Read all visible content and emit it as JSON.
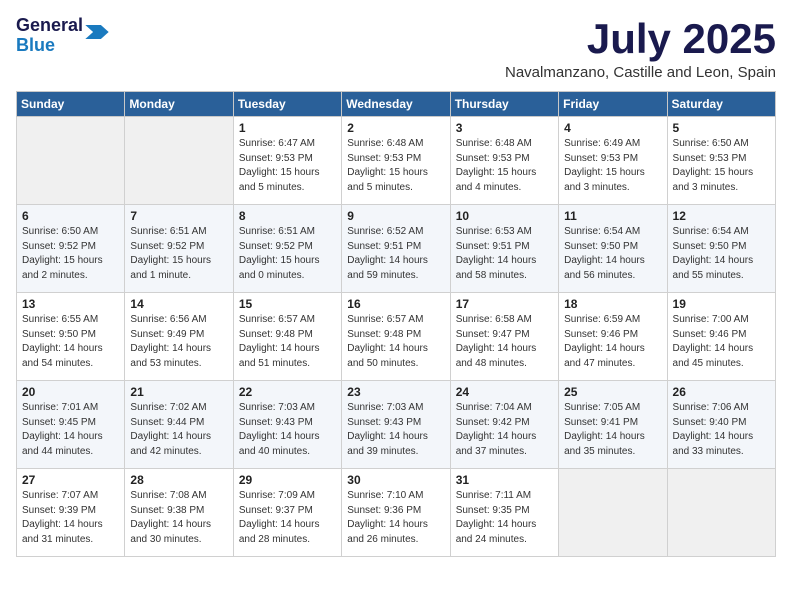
{
  "header": {
    "logo_line1": "General",
    "logo_line2": "Blue",
    "month": "July 2025",
    "location": "Navalmanzano, Castille and Leon, Spain"
  },
  "days_of_week": [
    "Sunday",
    "Monday",
    "Tuesday",
    "Wednesday",
    "Thursday",
    "Friday",
    "Saturday"
  ],
  "weeks": [
    [
      {
        "day": "",
        "info": ""
      },
      {
        "day": "",
        "info": ""
      },
      {
        "day": "1",
        "info": "Sunrise: 6:47 AM\nSunset: 9:53 PM\nDaylight: 15 hours\nand 5 minutes."
      },
      {
        "day": "2",
        "info": "Sunrise: 6:48 AM\nSunset: 9:53 PM\nDaylight: 15 hours\nand 5 minutes."
      },
      {
        "day": "3",
        "info": "Sunrise: 6:48 AM\nSunset: 9:53 PM\nDaylight: 15 hours\nand 4 minutes."
      },
      {
        "day": "4",
        "info": "Sunrise: 6:49 AM\nSunset: 9:53 PM\nDaylight: 15 hours\nand 3 minutes."
      },
      {
        "day": "5",
        "info": "Sunrise: 6:50 AM\nSunset: 9:53 PM\nDaylight: 15 hours\nand 3 minutes."
      }
    ],
    [
      {
        "day": "6",
        "info": "Sunrise: 6:50 AM\nSunset: 9:52 PM\nDaylight: 15 hours\nand 2 minutes."
      },
      {
        "day": "7",
        "info": "Sunrise: 6:51 AM\nSunset: 9:52 PM\nDaylight: 15 hours\nand 1 minute."
      },
      {
        "day": "8",
        "info": "Sunrise: 6:51 AM\nSunset: 9:52 PM\nDaylight: 15 hours\nand 0 minutes."
      },
      {
        "day": "9",
        "info": "Sunrise: 6:52 AM\nSunset: 9:51 PM\nDaylight: 14 hours\nand 59 minutes."
      },
      {
        "day": "10",
        "info": "Sunrise: 6:53 AM\nSunset: 9:51 PM\nDaylight: 14 hours\nand 58 minutes."
      },
      {
        "day": "11",
        "info": "Sunrise: 6:54 AM\nSunset: 9:50 PM\nDaylight: 14 hours\nand 56 minutes."
      },
      {
        "day": "12",
        "info": "Sunrise: 6:54 AM\nSunset: 9:50 PM\nDaylight: 14 hours\nand 55 minutes."
      }
    ],
    [
      {
        "day": "13",
        "info": "Sunrise: 6:55 AM\nSunset: 9:50 PM\nDaylight: 14 hours\nand 54 minutes."
      },
      {
        "day": "14",
        "info": "Sunrise: 6:56 AM\nSunset: 9:49 PM\nDaylight: 14 hours\nand 53 minutes."
      },
      {
        "day": "15",
        "info": "Sunrise: 6:57 AM\nSunset: 9:48 PM\nDaylight: 14 hours\nand 51 minutes."
      },
      {
        "day": "16",
        "info": "Sunrise: 6:57 AM\nSunset: 9:48 PM\nDaylight: 14 hours\nand 50 minutes."
      },
      {
        "day": "17",
        "info": "Sunrise: 6:58 AM\nSunset: 9:47 PM\nDaylight: 14 hours\nand 48 minutes."
      },
      {
        "day": "18",
        "info": "Sunrise: 6:59 AM\nSunset: 9:46 PM\nDaylight: 14 hours\nand 47 minutes."
      },
      {
        "day": "19",
        "info": "Sunrise: 7:00 AM\nSunset: 9:46 PM\nDaylight: 14 hours\nand 45 minutes."
      }
    ],
    [
      {
        "day": "20",
        "info": "Sunrise: 7:01 AM\nSunset: 9:45 PM\nDaylight: 14 hours\nand 44 minutes."
      },
      {
        "day": "21",
        "info": "Sunrise: 7:02 AM\nSunset: 9:44 PM\nDaylight: 14 hours\nand 42 minutes."
      },
      {
        "day": "22",
        "info": "Sunrise: 7:03 AM\nSunset: 9:43 PM\nDaylight: 14 hours\nand 40 minutes."
      },
      {
        "day": "23",
        "info": "Sunrise: 7:03 AM\nSunset: 9:43 PM\nDaylight: 14 hours\nand 39 minutes."
      },
      {
        "day": "24",
        "info": "Sunrise: 7:04 AM\nSunset: 9:42 PM\nDaylight: 14 hours\nand 37 minutes."
      },
      {
        "day": "25",
        "info": "Sunrise: 7:05 AM\nSunset: 9:41 PM\nDaylight: 14 hours\nand 35 minutes."
      },
      {
        "day": "26",
        "info": "Sunrise: 7:06 AM\nSunset: 9:40 PM\nDaylight: 14 hours\nand 33 minutes."
      }
    ],
    [
      {
        "day": "27",
        "info": "Sunrise: 7:07 AM\nSunset: 9:39 PM\nDaylight: 14 hours\nand 31 minutes."
      },
      {
        "day": "28",
        "info": "Sunrise: 7:08 AM\nSunset: 9:38 PM\nDaylight: 14 hours\nand 30 minutes."
      },
      {
        "day": "29",
        "info": "Sunrise: 7:09 AM\nSunset: 9:37 PM\nDaylight: 14 hours\nand 28 minutes."
      },
      {
        "day": "30",
        "info": "Sunrise: 7:10 AM\nSunset: 9:36 PM\nDaylight: 14 hours\nand 26 minutes."
      },
      {
        "day": "31",
        "info": "Sunrise: 7:11 AM\nSunset: 9:35 PM\nDaylight: 14 hours\nand 24 minutes."
      },
      {
        "day": "",
        "info": ""
      },
      {
        "day": "",
        "info": ""
      }
    ]
  ]
}
